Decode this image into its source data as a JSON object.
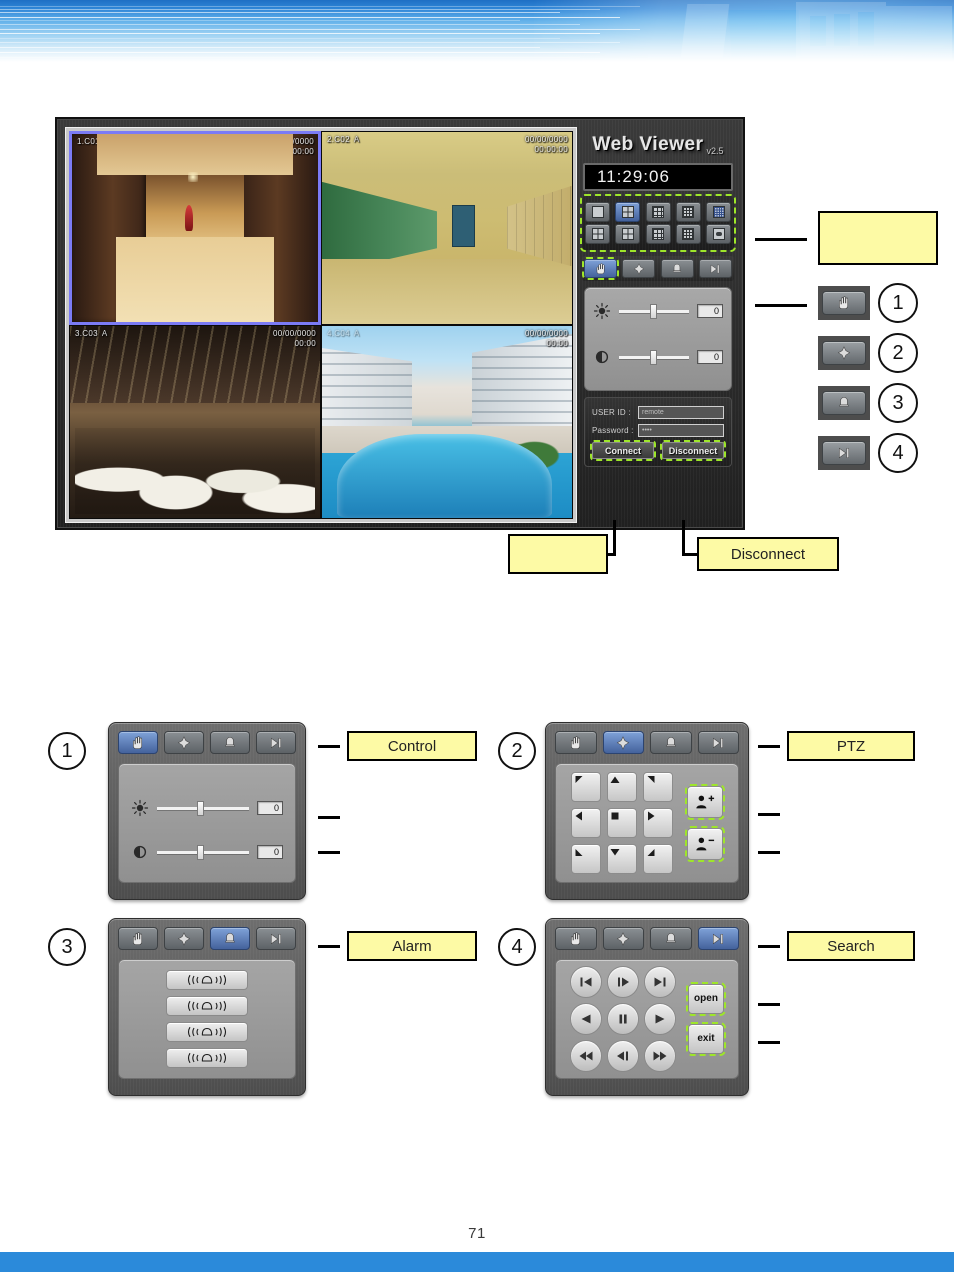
{
  "page": {
    "number": "71"
  },
  "viewer": {
    "title": "Web Viewer",
    "version": "v2.5",
    "clock": "11:29:06",
    "channels": [
      {
        "name": "1.C01",
        "alpha": "A",
        "date": "00/00/0000",
        "time": "00:00"
      },
      {
        "name": "2.C02",
        "alpha": "A",
        "date": "00/00/0000",
        "time": "00:00:00"
      },
      {
        "name": "3.C03",
        "alpha": "A",
        "date": "00/00/0000",
        "time": "00:00"
      },
      {
        "name": "4.C04",
        "alpha": "A",
        "date": "00/00/0000",
        "time": "00:00"
      }
    ],
    "layout_buttons": [
      {
        "name": "layout-1",
        "icon": "grid-1"
      },
      {
        "name": "layout-4",
        "icon": "grid-4"
      },
      {
        "name": "layout-9",
        "icon": "grid-9"
      },
      {
        "name": "layout-16",
        "icon": "grid-16"
      },
      {
        "name": "layout-25",
        "icon": "grid-25"
      },
      {
        "name": "layout-6",
        "icon": "grid-6"
      },
      {
        "name": "layout-8",
        "icon": "grid-8"
      },
      {
        "name": "layout-10",
        "icon": "grid-10"
      },
      {
        "name": "layout-13",
        "icon": "grid-13"
      },
      {
        "name": "layout-full",
        "icon": "fullscreen"
      }
    ],
    "tabs": [
      {
        "label": "Control",
        "icon": "hand-icon"
      },
      {
        "label": "PTZ",
        "icon": "ptz-icon"
      },
      {
        "label": "Alarm",
        "icon": "bell-icon"
      },
      {
        "label": "Search",
        "icon": "search-play-icon"
      }
    ],
    "controls": {
      "brightness": {
        "icon": "brightness-icon",
        "value": "0"
      },
      "contrast": {
        "icon": "contrast-icon",
        "value": "0"
      }
    },
    "login": {
      "userid_label": "USER ID :",
      "userid_value": "remote",
      "password_label": "Password :",
      "password_value": "••••",
      "connect_label": "Connect",
      "disconnect_label": "Disconnect"
    }
  },
  "callouts": {
    "layout_box": "",
    "tabs_box": "",
    "connect_box": "",
    "disconnect_box": "Disconnect",
    "numbers": [
      "1",
      "2",
      "3",
      "4"
    ]
  },
  "panels": [
    {
      "num": "1",
      "label": "Control",
      "active_tab": 0,
      "sliders": [
        {
          "icon": "brightness-icon",
          "value": "0"
        },
        {
          "icon": "contrast-icon",
          "value": "0"
        }
      ]
    },
    {
      "num": "2",
      "label": "PTZ",
      "active_tab": 1,
      "pad": [
        "up-left",
        "up",
        "up-right",
        "left",
        "stop",
        "right",
        "down-left",
        "down",
        "down-right"
      ],
      "zoom_buttons": [
        {
          "name": "zoom-in-button",
          "icon": "person-plus-icon"
        },
        {
          "name": "zoom-out-button",
          "icon": "person-minus-icon"
        }
      ]
    },
    {
      "num": "3",
      "label": "Alarm",
      "active_tab": 2,
      "alarm_buttons": [
        {
          "name": "alarm-1",
          "icon": "siren-icon"
        },
        {
          "name": "alarm-2",
          "icon": "siren-icon"
        },
        {
          "name": "alarm-3",
          "icon": "siren-icon"
        },
        {
          "name": "alarm-4",
          "icon": "siren-icon"
        }
      ]
    },
    {
      "num": "4",
      "label": "Search",
      "active_tab": 3,
      "transport": [
        "skip-back",
        "step-forward-frame",
        "skip-forward",
        "play-reverse",
        "pause",
        "play",
        "rewind",
        "step-back-frame",
        "fast-forward"
      ],
      "side_buttons": [
        {
          "name": "open-button",
          "label": "open"
        },
        {
          "name": "exit-button",
          "label": "exit"
        }
      ]
    }
  ]
}
